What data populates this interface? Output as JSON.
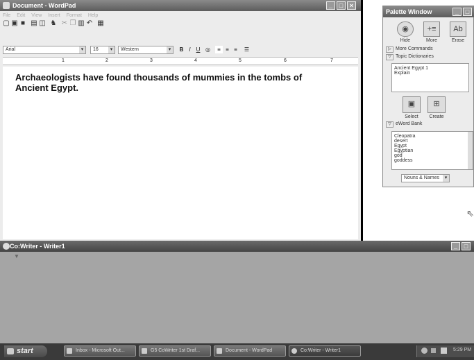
{
  "wordpad": {
    "title": "Document - WordPad",
    "menu": [
      "File",
      "Edit",
      "View",
      "Insert",
      "Format",
      "Help"
    ],
    "toolbar_icons": [
      "new-icon",
      "open-icon",
      "save-icon",
      "print-icon",
      "print-preview-icon",
      "find-icon",
      "cut-icon",
      "copy-icon",
      "paste-icon",
      "undo-icon",
      "date-time-icon"
    ],
    "font_name": "Arial",
    "font_size": "16",
    "script": "Western",
    "bold": "B",
    "italic": "I",
    "underline": "U",
    "ruler_numbers": [
      "1",
      "2",
      "3",
      "4",
      "5",
      "6",
      "7"
    ],
    "text_line1": "Archaeologists have found  thousands of mummies in the tombs of",
    "text_line2": "Ancient Egypt."
  },
  "palette": {
    "title": "Palette Window",
    "hide": "Hide",
    "more": "More",
    "erase": "Erase",
    "more_commands": "More Commands",
    "topic_dictionaries": "Topic Dictionaries",
    "topics": [
      "Ancient Egypt 1",
      "Explain"
    ],
    "select": "Select",
    "create": "Create",
    "eword_bank": "eWord Bank",
    "words": [
      "Cleopatra",
      "desert",
      "Egypt",
      "Egyptian",
      "god",
      "goddess"
    ],
    "filter": "Nouns & Names"
  },
  "cowriter": {
    "title": "Co:Writer - Writer1"
  },
  "taskbar": {
    "start": "start",
    "buttons": [
      "Inbox - Microsoft Out...",
      "G5 CoWriter 1st Draf...",
      "Document - WordPad",
      "Co:Writer - Writer1"
    ],
    "clock": "5:29 PM"
  },
  "colors": {
    "titlebar": "#6e6e6e",
    "window_bg": "#ececec",
    "cowriter_bg": "#a5a5a5",
    "taskbar": "#3a3a3a"
  }
}
